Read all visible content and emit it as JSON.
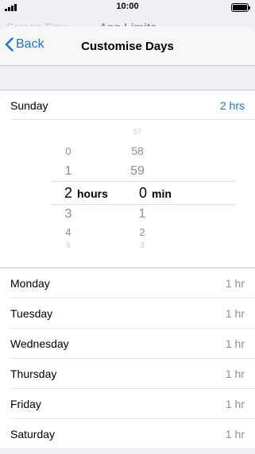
{
  "status_bar": {
    "time": "10:00"
  },
  "background_nav": {
    "back_label": "Screen Time",
    "title": "App Limits"
  },
  "nav": {
    "back_label": "Back",
    "title": "Customise Days"
  },
  "sunday": {
    "day": "Sunday",
    "value": "2 hrs"
  },
  "picker": {
    "hours": {
      "values": [
        "0",
        "1",
        "2",
        "3",
        "4",
        "5"
      ],
      "selected": "2",
      "unit": "hours"
    },
    "minutes": {
      "values": [
        "57",
        "58",
        "59",
        "0",
        "1",
        "2",
        "3"
      ],
      "selected": "0",
      "unit": "min"
    }
  },
  "days": [
    {
      "day": "Monday",
      "value": "1 hr"
    },
    {
      "day": "Tuesday",
      "value": "1 hr"
    },
    {
      "day": "Wednesday",
      "value": "1 hr"
    },
    {
      "day": "Thursday",
      "value": "1 hr"
    },
    {
      "day": "Friday",
      "value": "1 hr"
    },
    {
      "day": "Saturday",
      "value": "1 hr"
    }
  ],
  "colors": {
    "accent": "#1a73e8",
    "secondary": "#8e8e93",
    "background": "#efeff4"
  }
}
